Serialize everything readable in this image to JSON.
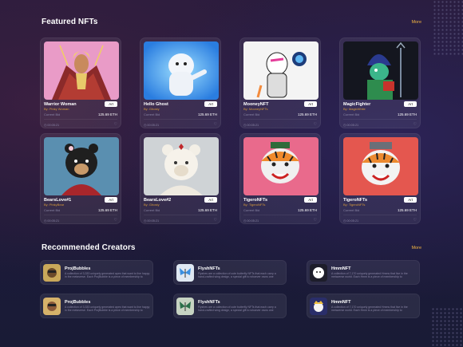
{
  "featured": {
    "title": "Featured NFTs",
    "more": "More",
    "cards": [
      {
        "name": "Warrior Woman",
        "by": "By: Pinky Woman",
        "tag": "Art",
        "current_bid_label": "Current Bid",
        "price": "125.69 ETH",
        "footer": "00:05:21"
      },
      {
        "name": "Hello Ghost",
        "by": "By: Ghosty",
        "tag": "Art",
        "current_bid_label": "Current Bid",
        "price": "125.69 ETH",
        "footer": "00:05:21"
      },
      {
        "name": "MooneyNFT",
        "by": "By: MooneyNFTs",
        "tag": "Art",
        "current_bid_label": "Current Bid",
        "price": "125.69 ETH",
        "footer": "00:05:21"
      },
      {
        "name": "MagicFighter",
        "by": "By: MagicWhite",
        "tag": "Art",
        "current_bid_label": "Current Bid",
        "price": "125.69 ETH",
        "footer": "00:05:21"
      },
      {
        "name": "BearsLove#1",
        "by": "By: PinkyBear",
        "tag": "Art",
        "current_bid_label": "Current Bid",
        "price": "125.69 ETH",
        "footer": "00:05:21"
      },
      {
        "name": "BearsLove#2",
        "by": "By: Ghosty",
        "tag": "Art",
        "current_bid_label": "Current Bid",
        "price": "125.69 ETH",
        "footer": "00:05:21"
      },
      {
        "name": "TigeroNFTs",
        "by": "By: TigeroNFTs",
        "tag": "Art",
        "current_bid_label": "Current Bid",
        "price": "125.69 ETH",
        "footer": "00:05:21"
      },
      {
        "name": "TigeroNFTs",
        "by": "By: TigeroNFTs",
        "tag": "Art",
        "current_bid_label": "Current Bid",
        "price": "125.69 ETH",
        "footer": "00:05:21"
      }
    ]
  },
  "recommended": {
    "title": "Recommended Creators",
    "more": "More",
    "creators": [
      {
        "name": "ProjBubbles",
        "desc": "A collection of 3,333 uniquely generated apes that want to live happy in the metaverse. Each ProjBubble is a piece of membership to"
      },
      {
        "name": "FlyshNFTs",
        "desc": "Flyshes are a collection of cute butterfly NFTs that each carry a hand-crafted wing design, a special gift to whoever owns one"
      },
      {
        "name": "HmmNFT",
        "desc": "A collection of 7,170 uniquely generated Hmms that live in the metaverse world. Each Hmm is a piece of membership to"
      },
      {
        "name": "ProjBubbles",
        "desc": "A collection of 3,333 uniquely generated apes that want to live happy in the metaverse. Each ProjBubble is a piece of membership to"
      },
      {
        "name": "FlyshNFTs",
        "desc": "Flyshes are a collection of cute butterfly NFTs that each carry a hand-crafted wing design, a special gift to whoever owns one"
      },
      {
        "name": "HmmNFT",
        "desc": "A collection of 7,170 uniquely generated Hmms that live in the metaverse world. Each Hmm is a piece of membership to"
      }
    ]
  },
  "colors": {
    "accent": "#f5b642",
    "creator_by": "#d79b3b",
    "muted": "#8a86a6"
  },
  "icons": {
    "timer": "clock-icon",
    "like": "heart-icon"
  }
}
